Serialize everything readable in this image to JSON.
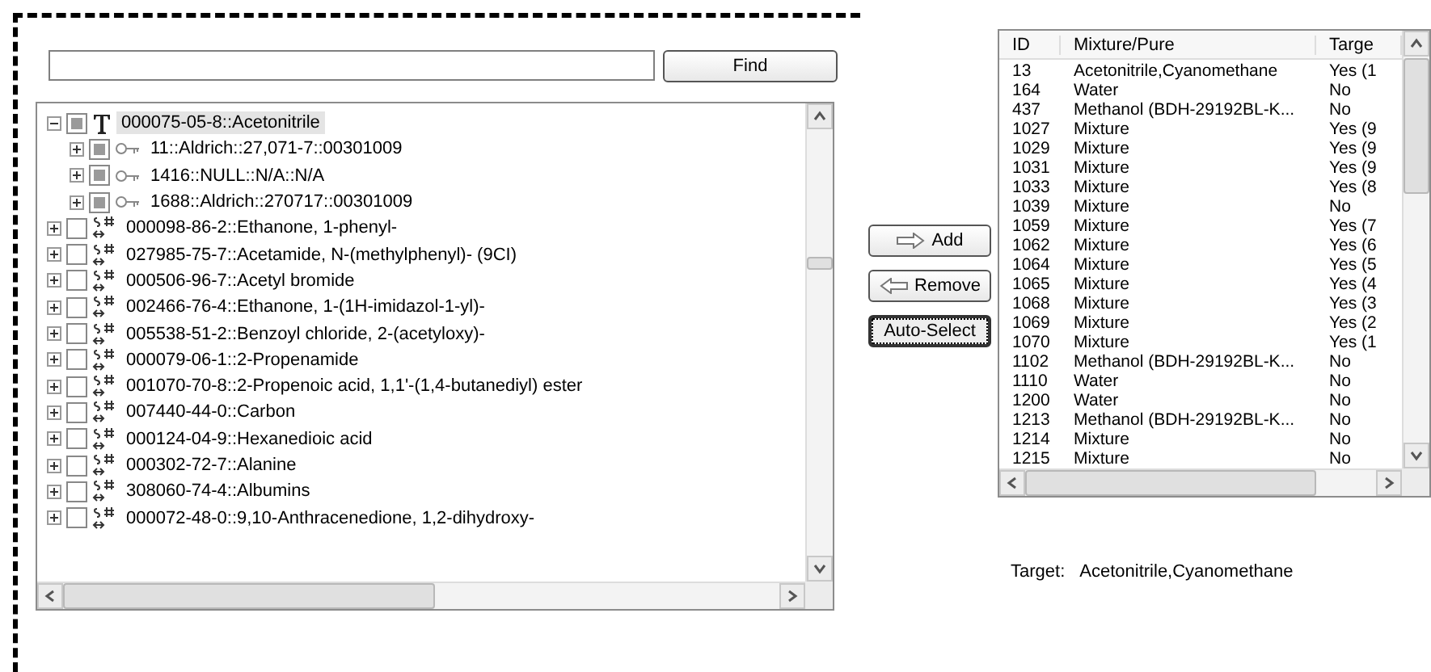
{
  "search": {
    "button": "Find"
  },
  "tree": [
    {
      "label": "000075-05-8::Acetonitrile",
      "kind": "text",
      "partial": true,
      "selected": true,
      "expanded": true,
      "children": [
        {
          "label": "11::Aldrich::27,071-7::00301009",
          "kind": "key",
          "partial": true,
          "selected": false,
          "expanded": false
        },
        {
          "label": "1416::NULL::N/A::N/A",
          "kind": "key",
          "partial": true,
          "selected": false,
          "expanded": false
        },
        {
          "label": "1688::Aldrich::270717::00301009",
          "kind": "key",
          "partial": true,
          "selected": false,
          "expanded": false
        }
      ]
    },
    {
      "label": "000098-86-2::Ethanone, 1-phenyl-",
      "kind": "structure",
      "partial": false,
      "selected": false,
      "expanded": false
    },
    {
      "label": "027985-75-7::Acetamide, N-(methylphenyl)- (9CI)",
      "kind": "structure",
      "partial": false,
      "selected": false,
      "expanded": false
    },
    {
      "label": "000506-96-7::Acetyl bromide",
      "kind": "structure",
      "partial": false,
      "selected": false,
      "expanded": false
    },
    {
      "label": "002466-76-4::Ethanone, 1-(1H-imidazol-1-yl)-",
      "kind": "structure",
      "partial": false,
      "selected": false,
      "expanded": false
    },
    {
      "label": "005538-51-2::Benzoyl chloride, 2-(acetyloxy)-",
      "kind": "structure",
      "partial": false,
      "selected": false,
      "expanded": false
    },
    {
      "label": "000079-06-1::2-Propenamide",
      "kind": "structure",
      "partial": false,
      "selected": false,
      "expanded": false
    },
    {
      "label": "001070-70-8::2-Propenoic acid, 1,1'-(1,4-butanediyl) ester",
      "kind": "structure",
      "partial": false,
      "selected": false,
      "expanded": false
    },
    {
      "label": "007440-44-0::Carbon",
      "kind": "structure",
      "partial": false,
      "selected": false,
      "expanded": false
    },
    {
      "label": "000124-04-9::Hexanedioic acid",
      "kind": "structure",
      "partial": false,
      "selected": false,
      "expanded": false
    },
    {
      "label": "000302-72-7::Alanine",
      "kind": "structure",
      "partial": false,
      "selected": false,
      "expanded": false
    },
    {
      "label": "308060-74-4::Albumins",
      "kind": "structure",
      "partial": false,
      "selected": false,
      "expanded": false
    },
    {
      "label": "000072-48-0::9,10-Anthracenedione, 1,2-dihydroxy-",
      "kind": "structure",
      "partial": false,
      "selected": false,
      "expanded": false
    }
  ],
  "actions": [
    {
      "label": "Add",
      "kind": "add"
    },
    {
      "label": "Remove",
      "kind": "remove"
    },
    {
      "label": "Auto-Select",
      "kind": "focused"
    }
  ],
  "table": {
    "columns": [
      "ID",
      "Mixture/Pure",
      "Targe"
    ],
    "rows": [
      [
        "13",
        "Acetonitrile,Cyanomethane",
        "Yes (1"
      ],
      [
        "164",
        "Water",
        "No"
      ],
      [
        "437",
        "Methanol (BDH-29192BL-K...",
        "No"
      ],
      [
        "1027",
        "Mixture",
        "Yes (9"
      ],
      [
        "1029",
        "Mixture",
        "Yes (9"
      ],
      [
        "1031",
        "Mixture",
        "Yes (9"
      ],
      [
        "1033",
        "Mixture",
        "Yes (8"
      ],
      [
        "1039",
        "Mixture",
        "No"
      ],
      [
        "1059",
        "Mixture",
        "Yes (7"
      ],
      [
        "1062",
        "Mixture",
        "Yes (6"
      ],
      [
        "1064",
        "Mixture",
        "Yes (5"
      ],
      [
        "1065",
        "Mixture",
        "Yes (4"
      ],
      [
        "1068",
        "Mixture",
        "Yes (3"
      ],
      [
        "1069",
        "Mixture",
        "Yes (2"
      ],
      [
        "1070",
        "Mixture",
        "Yes (1"
      ],
      [
        "1102",
        "Methanol (BDH-29192BL-K...",
        "No"
      ],
      [
        "1110",
        "Water",
        "No"
      ],
      [
        "1200",
        "Water",
        "No"
      ],
      [
        "1213",
        "Methanol (BDH-29192BL-K...",
        "No"
      ],
      [
        "1214",
        "Mixture",
        "No"
      ],
      [
        "1215",
        "Mixture",
        "No"
      ]
    ]
  },
  "target": {
    "label": "Target:",
    "value": "Acetonitrile,Cyanomethane"
  }
}
